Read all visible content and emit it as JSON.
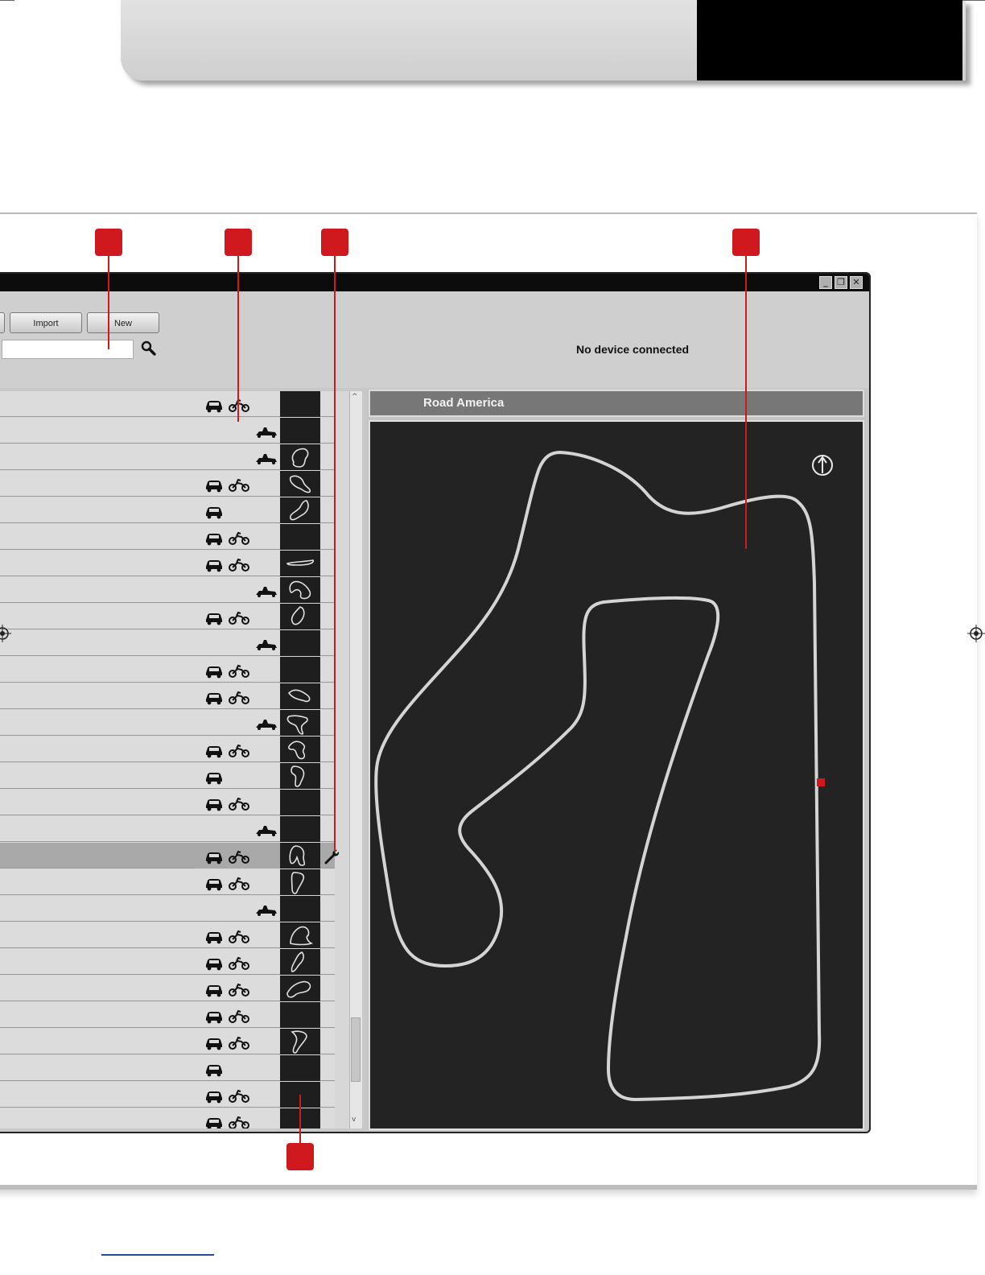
{
  "toolbar": {
    "import_label": "Import",
    "new_label": "New",
    "search_placeholder": "",
    "status_text": "No device connected"
  },
  "window_controls": {
    "minimize": "_",
    "restore": "❐",
    "close": "✕"
  },
  "track_panel": {
    "track_name": "Road America"
  },
  "colors": {
    "callout": "#d0181f",
    "map_bg": "#232323",
    "track_line": "#d0d0d0",
    "marker": "#d0181f"
  },
  "track_list": {
    "rows": [
      {
        "car": true,
        "moto": true,
        "kart": false,
        "map": "none",
        "selected": false,
        "wrench": false
      },
      {
        "car": false,
        "moto": false,
        "kart": true,
        "map": "none",
        "selected": false,
        "wrench": false
      },
      {
        "car": false,
        "moto": false,
        "kart": true,
        "map": "a",
        "selected": false,
        "wrench": false
      },
      {
        "car": true,
        "moto": true,
        "kart": false,
        "map": "b",
        "selected": false,
        "wrench": false
      },
      {
        "car": true,
        "moto": false,
        "kart": false,
        "map": "c",
        "selected": false,
        "wrench": false
      },
      {
        "car": true,
        "moto": true,
        "kart": false,
        "map": "none",
        "selected": false,
        "wrench": false
      },
      {
        "car": true,
        "moto": true,
        "kart": false,
        "map": "d",
        "selected": false,
        "wrench": false
      },
      {
        "car": false,
        "moto": false,
        "kart": true,
        "map": "e",
        "selected": false,
        "wrench": false
      },
      {
        "car": true,
        "moto": true,
        "kart": false,
        "map": "f",
        "selected": false,
        "wrench": false
      },
      {
        "car": false,
        "moto": false,
        "kart": true,
        "map": "none",
        "selected": false,
        "wrench": false
      },
      {
        "car": true,
        "moto": true,
        "kart": false,
        "map": "none",
        "selected": false,
        "wrench": false
      },
      {
        "car": true,
        "moto": true,
        "kart": false,
        "map": "g",
        "selected": false,
        "wrench": false
      },
      {
        "car": false,
        "moto": false,
        "kart": true,
        "map": "h",
        "selected": false,
        "wrench": false
      },
      {
        "car": true,
        "moto": true,
        "kart": false,
        "map": "i",
        "selected": false,
        "wrench": false
      },
      {
        "car": true,
        "moto": false,
        "kart": false,
        "map": "j",
        "selected": false,
        "wrench": false
      },
      {
        "car": true,
        "moto": true,
        "kart": false,
        "map": "none",
        "selected": false,
        "wrench": false
      },
      {
        "car": false,
        "moto": false,
        "kart": true,
        "map": "none",
        "selected": false,
        "wrench": false
      },
      {
        "car": true,
        "moto": true,
        "kart": false,
        "map": "k",
        "selected": true,
        "wrench": true
      },
      {
        "car": true,
        "moto": true,
        "kart": false,
        "map": "l",
        "selected": false,
        "wrench": false
      },
      {
        "car": false,
        "moto": false,
        "kart": true,
        "map": "none",
        "selected": false,
        "wrench": false
      },
      {
        "car": true,
        "moto": true,
        "kart": false,
        "map": "m",
        "selected": false,
        "wrench": false
      },
      {
        "car": true,
        "moto": true,
        "kart": false,
        "map": "n",
        "selected": false,
        "wrench": false
      },
      {
        "car": true,
        "moto": true,
        "kart": false,
        "map": "o",
        "selected": false,
        "wrench": false
      },
      {
        "car": true,
        "moto": true,
        "kart": false,
        "map": "none",
        "selected": false,
        "wrench": false
      },
      {
        "car": true,
        "moto": true,
        "kart": false,
        "map": "p",
        "selected": false,
        "wrench": false
      },
      {
        "car": true,
        "moto": false,
        "kart": false,
        "map": "none",
        "selected": false,
        "wrench": false
      },
      {
        "car": true,
        "moto": true,
        "kart": false,
        "map": "none",
        "selected": false,
        "wrench": false
      },
      {
        "car": true,
        "moto": true,
        "kart": false,
        "map": "none",
        "selected": false,
        "wrench": false
      }
    ]
  }
}
